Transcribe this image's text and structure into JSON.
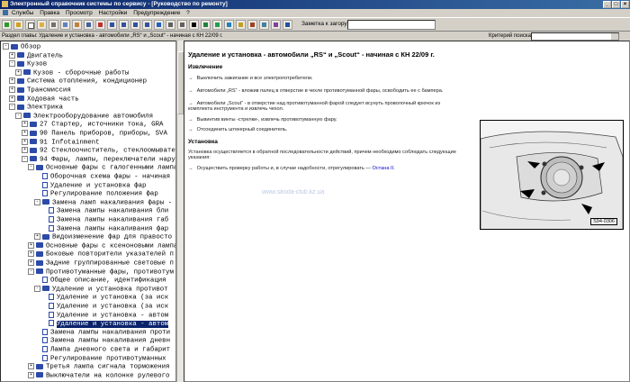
{
  "window": {
    "title": "Электронный справочник системы по сервису - [Руководство по ремонту]"
  },
  "menu": [
    "Службы",
    "Правка",
    "Просмотр",
    "Настройки",
    "Предупреждение",
    "?"
  ],
  "toolbar": {
    "bookmark_label": "Заметка к загору:",
    "bookmark_value": ""
  },
  "chapter_bar": {
    "chapter_label": "Раздел главы: Удаление и установка - автомобили „RS“ и „Scout“ - начиная с КН 22/09 г.",
    "criteria_label": "Критерий поиска:",
    "criteria_value": ""
  },
  "tree": [
    {
      "label": "Обзор",
      "icon": "book",
      "expander": "-"
    },
    {
      "label": "Двигатель",
      "icon": "book",
      "expander": "+"
    },
    {
      "label": "Кузов",
      "icon": "book",
      "expander": "-"
    },
    {
      "label": "Кузов - сборочные работы",
      "icon": "book",
      "expander": "+"
    },
    {
      "label": "Система отопления, кондиционер",
      "icon": "book",
      "expander": "+"
    },
    {
      "label": "Трансмиссия",
      "icon": "book",
      "expander": "+"
    },
    {
      "label": "Ходовая часть",
      "icon": "book",
      "expander": "+"
    },
    {
      "label": "Электрика",
      "icon": "book",
      "expander": "-"
    },
    {
      "label": "Электрооборудование автомобиля",
      "icon": "book",
      "expander": "-"
    },
    {
      "label": "27 Стартер, источники тока, GRA",
      "icon": "book",
      "expander": "+"
    },
    {
      "label": "90 Панель приборов, приборы, SVA",
      "icon": "book",
      "expander": "+"
    },
    {
      "label": "91 Infotainment",
      "icon": "book",
      "expander": "+"
    },
    {
      "label": "92 Стеклоочиститель, стеклоомывате",
      "icon": "book",
      "expander": "+"
    },
    {
      "label": "94 Фары, лампы, переключатели нару",
      "icon": "book",
      "expander": "-"
    },
    {
      "label": "Основные фары с галогенными лампа",
      "icon": "book",
      "expander": "-"
    },
    {
      "label": "Оборочная схема фары - начиная",
      "icon": "page",
      "expander": ""
    },
    {
      "label": "Удаление и установка фар",
      "icon": "page",
      "expander": ""
    },
    {
      "label": "Регулирование положения фар",
      "icon": "page",
      "expander": ""
    },
    {
      "label": "Замена ламп накаливания фары -",
      "icon": "book",
      "expander": "-"
    },
    {
      "label": "Замена лампы накаливания бли",
      "icon": "page",
      "expander": ""
    },
    {
      "label": "Замена лампы накаливания габ",
      "icon": "page",
      "expander": ""
    },
    {
      "label": "Замена лампы накаливания фар",
      "icon": "page",
      "expander": ""
    },
    {
      "label": "Видоизменение фар для правосто",
      "icon": "book",
      "expander": "+"
    },
    {
      "label": "Основные фары с ксеноновыми лампа",
      "icon": "book",
      "expander": "+"
    },
    {
      "label": "Боковые повторители указателей п",
      "icon": "book",
      "expander": "+"
    },
    {
      "label": "Задние группированные световые п",
      "icon": "book",
      "expander": "+"
    },
    {
      "label": "Противотуманные фары, противотум",
      "icon": "book",
      "expander": "-"
    },
    {
      "label": "Общее описание, идентификация",
      "icon": "page",
      "expander": ""
    },
    {
      "label": "Удаление и установка противот",
      "icon": "book",
      "expander": "-"
    },
    {
      "label": "Удаление и установка (за иск",
      "icon": "page",
      "expander": ""
    },
    {
      "label": "Удаление и установка (за иск",
      "icon": "page",
      "expander": ""
    },
    {
      "label": "Удаление и установка - автом",
      "icon": "page",
      "expander": ""
    },
    {
      "label": "Удаление и установка - автом",
      "icon": "page",
      "expander": "",
      "selected": true
    },
    {
      "label": "Замена лампы накаливания проти",
      "icon": "page",
      "expander": ""
    },
    {
      "label": "Замена лампы накаливания дневн",
      "icon": "page",
      "expander": ""
    },
    {
      "label": "Лампа дневного света и габарит",
      "icon": "page",
      "expander": ""
    },
    {
      "label": "Регулирование противотуманных",
      "icon": "page",
      "expander": ""
    },
    {
      "label": "Третья лампа сигнала торможения",
      "icon": "book",
      "expander": "+"
    },
    {
      "label": "Выключатели на колонке рулевого",
      "icon": "book",
      "expander": "+"
    }
  ],
  "content": {
    "title": "Удаление и установка - автомобили „RS“ и „Scout“ - начиная с КН 22/09 г.",
    "removal_heading": "Извлечение",
    "removal_steps": [
      "Выключить зажигание и все электропотребители.",
      "Автомобили „RS“ - вложив палец в отверстие в чехле противотуманной фары, освободить ее с бампера.",
      "Автомобили „Scout“ - в отверстие над противотуманной фарой следует всунуть проволочный крючок из комплекта инструмента и извлечь чехол.",
      "Вывинтив винты -стрелки-, извлечь противотуманную фару.",
      "Отсоединить штекерный соединитель."
    ],
    "install_heading": "Установка",
    "install_text": "Установка осуществляется в обратной последовательности действий, причем необходимо соблюдать следующие указания:",
    "install_step": "Осуществить проверку работы и, в случае надобности, отрегулировать —",
    "install_link": "Остана II.",
    "figure_label": "S94-0306",
    "watermark": "www.skoda-club.kz.ua"
  },
  "colors": {
    "title_bar": "#0a246a",
    "selection": "#0a246a",
    "tree_icon": "#2c4aa8"
  }
}
